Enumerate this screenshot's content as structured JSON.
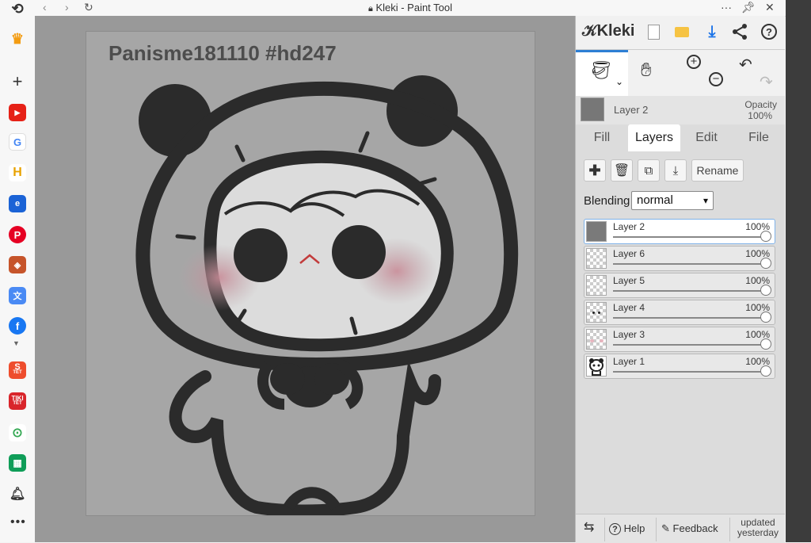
{
  "window": {
    "title": "Kleki - Paint Tool"
  },
  "sidebar": {
    "badge_text": "TẾT"
  },
  "canvas": {
    "title": "Panisme181110 #hd247"
  },
  "panel": {
    "logo": "Kleki",
    "active_layer": {
      "name": "Layer 2",
      "opacity_label": "Opacity",
      "opacity_value": "100%"
    },
    "tabs": [
      {
        "label": "Fill"
      },
      {
        "label": "Layers"
      },
      {
        "label": "Edit"
      },
      {
        "label": "File"
      }
    ],
    "rename_label": "Rename",
    "blending_label": "Blending",
    "blending_value": "normal",
    "layers": [
      {
        "name": "Layer 2",
        "opacity": "100%"
      },
      {
        "name": "Layer 6",
        "opacity": "100%"
      },
      {
        "name": "Layer 5",
        "opacity": "100%"
      },
      {
        "name": "Layer 4",
        "opacity": "100%"
      },
      {
        "name": "Layer 3",
        "opacity": "100%"
      },
      {
        "name": "Layer 1",
        "opacity": "100%"
      }
    ],
    "footer": {
      "help": "Help",
      "feedback": "Feedback",
      "updated_line1": "updated",
      "updated_line2": "yesterday"
    }
  }
}
